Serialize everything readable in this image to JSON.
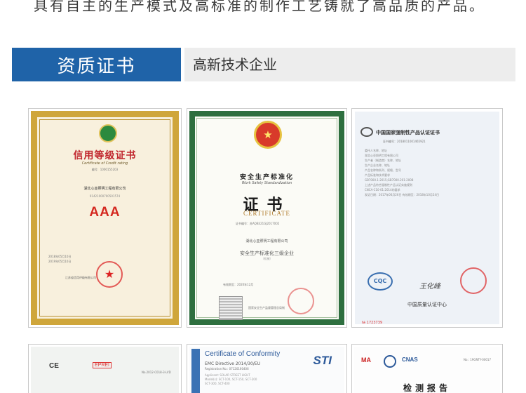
{
  "intro_text": "具有自主的生产模式及高标准的制作工艺铸就了高品质的产品。",
  "section": {
    "title": "资质证书",
    "subtitle": "高新技术企业"
  },
  "certificates": [
    {
      "name": "credit-rating",
      "title": "信用等级证书",
      "subtitle_en": "Certificate of Credit rating",
      "number": "编号：1000155203",
      "company": "湖北心亚照明工程有限公司",
      "code": "91421000700501574",
      "grade": "AAA",
      "dates": [
        "2018年05月10日",
        "2019年05月10日"
      ],
      "seal": "★",
      "issuer": "江苏省信用评级有限公司"
    },
    {
      "name": "work-safety",
      "emblem": "★",
      "title_cn": "安全生产标准化",
      "title_en": "Work Safety Standardization",
      "cert_cn": "证书",
      "cert_en": "CERTIFICATE",
      "number": "证书编号：苏AQB321GJ2017002",
      "company": "湖北心亚照明工程有限公司",
      "level": "安全生产标准化三级企业",
      "level_sub": "（机械）",
      "valid": "有效期至：2020年12月",
      "issuer": "国家安全生产监督管理总局制"
    },
    {
      "name": "ccc",
      "title": "中国国家强制性产品认证证书",
      "number": "证书编号：2018011001465921",
      "body_lines": [
        "委托人名称、地址",
        "湖北心亚照明工程有限公司",
        "生产者（制造商）名称、地址",
        "生产企业名称、地址",
        "产品名称和系列、规格、型号",
        "产品标准和技术要求",
        "GB7000.1-2015;GB7000.201-2008",
        "上述产品符合强制性产品认证实施规则",
        "CNCA-C10-01:2014的要求",
        "发证日期：2017年06月26日  有效期至：2018年10月24日"
      ],
      "logo": "CQC",
      "signature": "王化峰",
      "center": "中国质量认证中心",
      "serial": "№ 1723739"
    },
    {
      "name": "ce-emc",
      "mark": "CE",
      "lab": "EPREI",
      "number": "No.2012-C018-3-LVD"
    },
    {
      "name": "conformity",
      "title": "Certificate of Conformity",
      "directive": "EMC Directive 2014/30/EU",
      "reg": "Registration No.: 07120160406",
      "logo": "STI",
      "rows": [
        "Applicant: SOLAR STREET LIGHT",
        "Model(s): SCT-100, SCT-150, SCT-200",
        "SCT-300, SCT-400"
      ]
    },
    {
      "name": "inspection-report",
      "logo_ma": "MA",
      "logo_cnas": "CNAS",
      "number": "No.: 19GNTY-00017",
      "title": "检测报告"
    }
  ]
}
